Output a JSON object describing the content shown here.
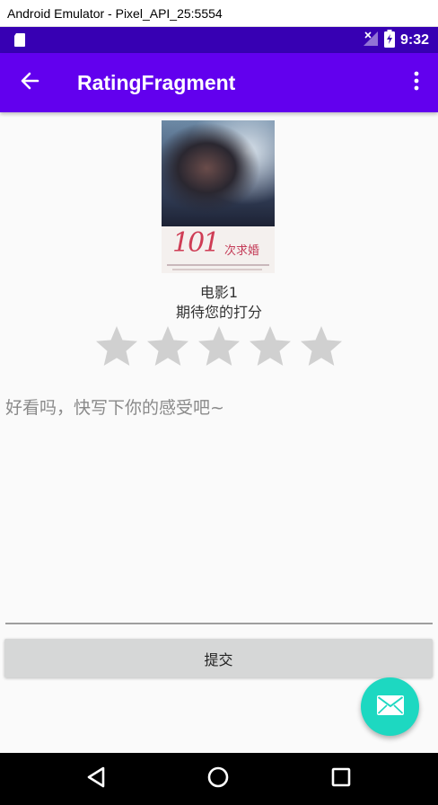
{
  "window": {
    "title": "Android Emulator - Pixel_API_25:5554"
  },
  "status_bar": {
    "time": "9:32",
    "icons": [
      "sd-card-icon",
      "no-signal-icon",
      "battery-charging-icon"
    ]
  },
  "app_bar": {
    "title": "RatingFragment",
    "back_icon": "arrow-back-icon",
    "menu_icon": "more-vert-icon"
  },
  "movie": {
    "poster_title": "101",
    "poster_subtitle": "次求婚",
    "name": "电影1",
    "rating_hint": "期待您的打分",
    "rating": 0,
    "max_rating": 5
  },
  "comment": {
    "placeholder": "好看吗，快写下你的感受吧~",
    "value": ""
  },
  "submit": {
    "label": "提交"
  },
  "fab": {
    "icon": "mail-icon"
  },
  "nav": {
    "icons": [
      "back-triangle-icon",
      "home-circle-icon",
      "recents-square-icon"
    ]
  },
  "colors": {
    "status_bar": "#3700b3",
    "app_bar": "#6200ee",
    "fab": "#1dd8c1",
    "star_empty": "#d0d0d0"
  }
}
